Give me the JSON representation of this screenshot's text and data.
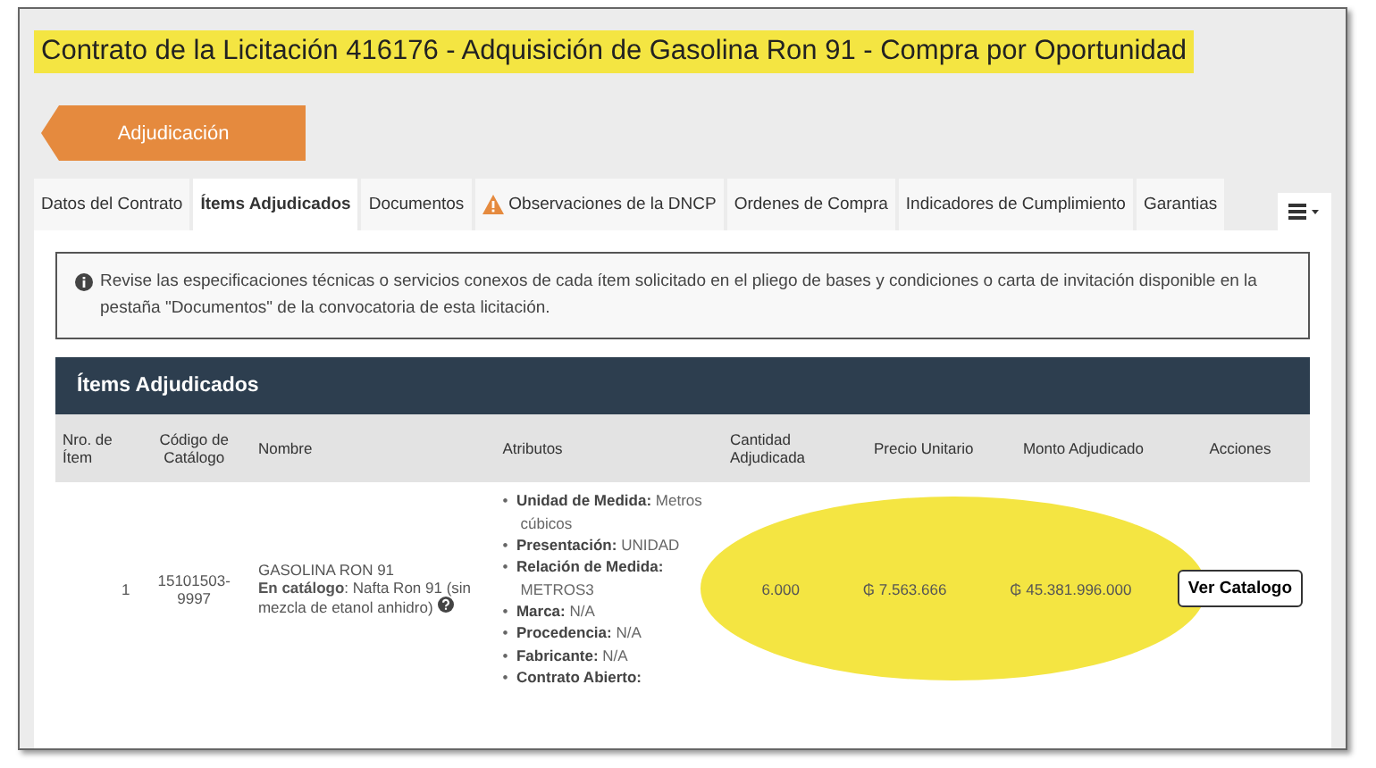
{
  "title": {
    "text": "Contrato de la Licitación 416176 - Adquisición de Gasolina Ron 91 - Compra por Oportunidad",
    "highlighted": true
  },
  "stage_button": "Adjudicación",
  "tabs": [
    {
      "label": "Datos del Contrato",
      "selected": false,
      "kind": "plain"
    },
    {
      "label": "Ítems Adjudicados",
      "selected": true,
      "kind": "plain"
    },
    {
      "label": "Documentos",
      "selected": false,
      "kind": "plain"
    },
    {
      "label": "Observaciones de la DNCP",
      "selected": false,
      "kind": "warning"
    },
    {
      "label": "Ordenes de Compra",
      "selected": false,
      "kind": "plain"
    },
    {
      "label": "Indicadores de Cumplimiento",
      "selected": false,
      "kind": "plain"
    },
    {
      "label": "Garantias",
      "selected": false,
      "kind": "plain"
    }
  ],
  "notice": "Revise las especificaciones técnicas o servicios conexos de cada ítem solicitado en el pliego de bases y condiciones o carta de invitación disponible en la pestaña \"Documentos\" de la convocatoria de esta licitación.",
  "table": {
    "title": "Ítems Adjudicados",
    "columns": [
      "Nro. de Ítem",
      "Código de Catálogo",
      "Nombre",
      "Atributos",
      "Cantidad Adjudicada",
      "Precio Unitario",
      "Monto Adjudicado",
      "Acciones"
    ],
    "rows": [
      {
        "number": "1",
        "code": "15101503-9997",
        "name": "GASOLINA RON 91",
        "catalog": "**En catálogo**: Nafta Ron 91 (sin mezcla de etanol anhidro)",
        "attributes": [
          {
            "marker": "•",
            "label": "Unidad de Medida:",
            "value": "Metros cúbicos"
          },
          {
            "marker": "•",
            "label": "Presentación:",
            "value": "UNIDAD"
          },
          {
            "marker": "•",
            "label": "Relación de Medida:",
            "value": "METROS3"
          },
          {
            "marker": "•",
            "label": "Marca:",
            "value": "N/A"
          },
          {
            "marker": "•",
            "label": "Procedencia:",
            "value": "N/A"
          },
          {
            "marker": "•",
            "label": "Fabricante:",
            "value": "N/A"
          },
          {
            "marker": "•",
            "label": "Contrato Abierto:"
          }
        ],
        "quantity": "6.000",
        "unit_price": "₲ 7.563.666",
        "amount": "₲ 45.381.996.000",
        "action": "Ver Catalogo",
        "highlighted": true
      }
    ]
  }
}
